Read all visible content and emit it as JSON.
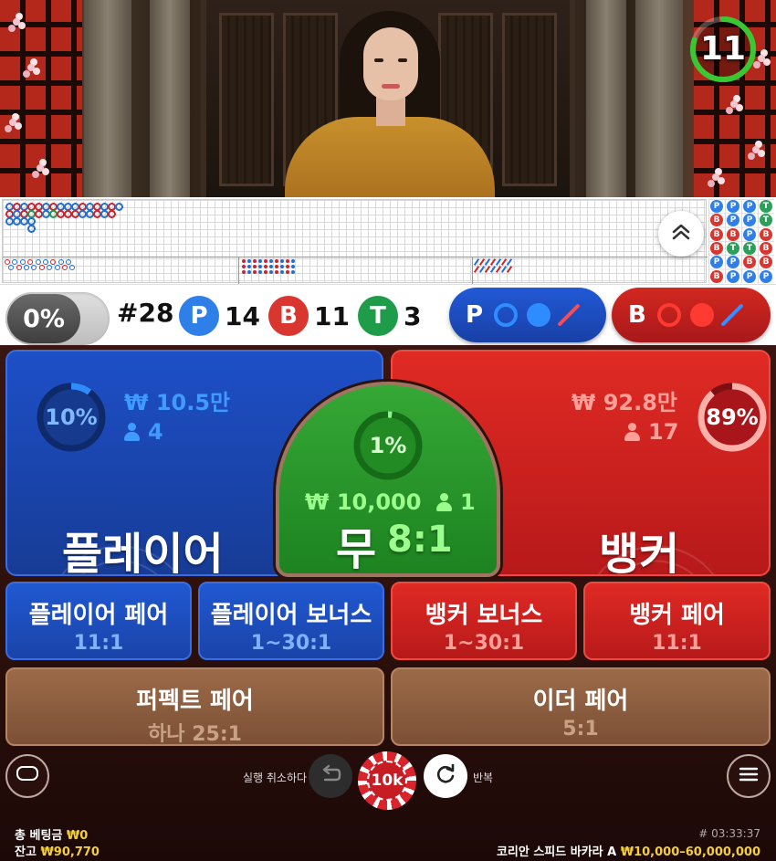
{
  "timer": {
    "seconds": "11",
    "ring_color": "#39c832",
    "fraction_remaining": 0.8
  },
  "stats": {
    "percent_toggle": "0%",
    "round": "#28",
    "player": {
      "letter": "P",
      "count": "14",
      "color": "#1e6fd9"
    },
    "banker": {
      "letter": "B",
      "count": "11",
      "color": "#d4202a"
    },
    "tie": {
      "letter": "T",
      "count": "3",
      "color": "#1e9c4a"
    }
  },
  "predict": {
    "player": {
      "letter": "P",
      "color": "#1b4fc7"
    },
    "banker": {
      "letter": "B",
      "color": "#c3221d"
    }
  },
  "roadmap": {
    "expand_icon": "chevron-up-double-icon",
    "bead_plate": [
      [
        "P",
        "B",
        "B",
        "B",
        "P",
        "B"
      ],
      [
        "P",
        "P",
        "B",
        "T",
        "P",
        "P"
      ],
      [
        "P",
        "P",
        "P",
        "T",
        "B",
        "P"
      ],
      [
        "T",
        "T",
        "B",
        "B",
        "B",
        "P"
      ]
    ]
  },
  "player_zone": {
    "label": "플레이어",
    "percent": "10%",
    "percent_value": 10,
    "amount": "₩ 10.5만",
    "players": "4",
    "accent": "#2f8cff"
  },
  "banker_zone": {
    "label": "뱅커",
    "percent": "89%",
    "percent_value": 89,
    "amount": "₩ 92.8만",
    "players": "17",
    "accent": "#ff9a90"
  },
  "tie_zone": {
    "label": "무",
    "odds": "8:1",
    "percent": "1%",
    "percent_value": 1,
    "amount": "₩ 10,000",
    "players": "1"
  },
  "side_bets": [
    {
      "name": "플레이어 페어",
      "odds": "11:1"
    },
    {
      "name": "플레이어 보너스",
      "odds": "1~30:1"
    },
    {
      "name": "뱅커 보너스",
      "odds": "1~30:1"
    },
    {
      "name": "뱅커 페어",
      "odds": "11:1"
    },
    {
      "name": "퍼펙트 페어",
      "odds": "하나 25:1"
    },
    {
      "name": "이더 페어",
      "odds": "5:1"
    }
  ],
  "controls": {
    "undo_label": "실행 취소하다",
    "chip_value": "10k",
    "repeat_label": "반복"
  },
  "footer": {
    "total_bet_label": "총 베팅금",
    "total_bet_value": "₩0",
    "balance_label": "잔고",
    "balance_value": "₩90,770",
    "game_id": "# 03:33:37",
    "table_name": "코리안 스피드 바카라 A",
    "limits": "₩10,000–60,000,000"
  }
}
